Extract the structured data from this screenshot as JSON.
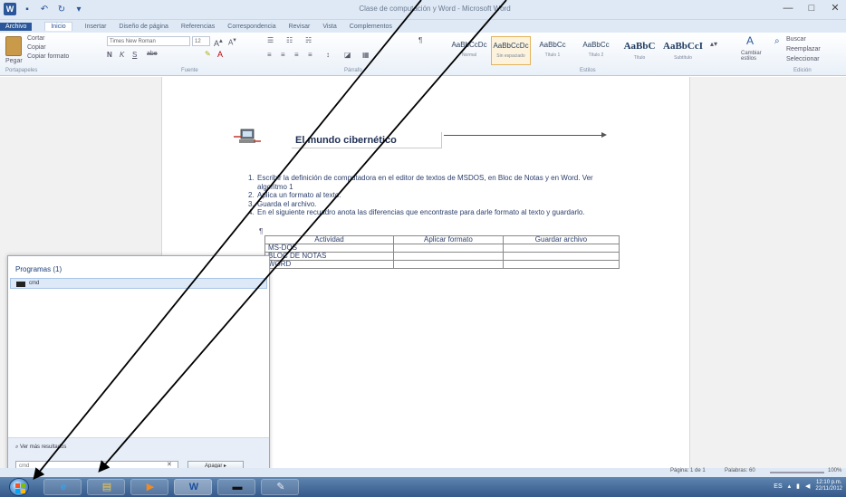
{
  "window": {
    "title": "Clase de computación y Word - Microsoft Word",
    "controls": {
      "minimize": "—",
      "maximize": "□",
      "close": "✕"
    }
  },
  "ribbon": {
    "tabs": [
      {
        "label": "Archivo"
      },
      {
        "label": "Inicio"
      },
      {
        "label": "Insertar"
      },
      {
        "label": "Diseño de página"
      },
      {
        "label": "Referencias"
      },
      {
        "label": "Correspondencia"
      },
      {
        "label": "Revisar"
      },
      {
        "label": "Vista"
      },
      {
        "label": "Complementos"
      }
    ],
    "clipboard": {
      "cut": "Cortar",
      "copy": "Copiar",
      "paste": "Pegar",
      "format_painter": "Copiar formato",
      "group": "Portapapeles"
    },
    "font": {
      "name": "Times New Roman",
      "size": "12",
      "group": "Fuente"
    },
    "paragraph_group": "Párrafo",
    "styles": [
      {
        "sample": "AaBbCcDc",
        "name": "Normal"
      },
      {
        "sample": "AaBbCcDc",
        "name": "Sin espaciado"
      },
      {
        "sample": "AaBbCc",
        "name": "Título 1"
      },
      {
        "sample": "AaBbCc",
        "name": "Título 2"
      },
      {
        "sample": "AaBbC",
        "name": "Título"
      },
      {
        "sample": "AaBbCcI",
        "name": "Subtítulo"
      }
    ],
    "styles_group": "Estilos",
    "change_styles": "Cambiar estilos",
    "editing": {
      "find": "Buscar",
      "replace": "Reemplazar",
      "select": "Seleccionar",
      "group": "Edición"
    }
  },
  "document": {
    "title": "El mundo cibernético",
    "steps": [
      "Escribir la definición de computadora en el editor de textos de MSDOS, en Bloc de Notas y en Word. Ver algoritmo 1",
      "Aplica un formato al texto.",
      "Guarda el archivo.",
      "En el siguiente recuadro anota las diferencias que encontraste para darle formato al texto y guardarlo."
    ],
    "step_numbers": [
      "1.",
      "2.",
      "3.",
      "4."
    ],
    "para_mark": "¶",
    "table": {
      "headers": [
        "Actividad",
        "Aplicar formato",
        "Guardar archivo"
      ],
      "rows": [
        [
          "MS-DOS",
          "",
          ""
        ],
        [
          "BLOC DE NOTAS",
          "",
          ""
        ],
        [
          "WORD",
          "",
          ""
        ]
      ]
    }
  },
  "start_menu": {
    "section_header": "Programas (1)",
    "results": [
      {
        "label": "cmd"
      }
    ],
    "see_more": "Ver más resultados",
    "search_value": "cmd",
    "clear": "✕",
    "shutdown_label": "Apagar ▸"
  },
  "statusbar": {
    "page": "Página: 1 de 1",
    "words": "Palabras: 60",
    "zoom": "100%"
  },
  "taskbar": {
    "apps": [
      {
        "name": "internet-explorer",
        "glyph": "e"
      },
      {
        "name": "file-explorer",
        "glyph": "▤"
      },
      {
        "name": "media-player",
        "glyph": "▶"
      },
      {
        "name": "word",
        "glyph": "W"
      },
      {
        "name": "cmd",
        "glyph": "▬"
      },
      {
        "name": "paint",
        "glyph": "✎"
      }
    ],
    "clock_time": "12:10 p.m.",
    "clock_date": "22/11/2012",
    "lang": "ES"
  },
  "colors": {
    "accent": "#2b579a",
    "doc_text": "#2b3f6b",
    "taskbar": "#34598a"
  }
}
